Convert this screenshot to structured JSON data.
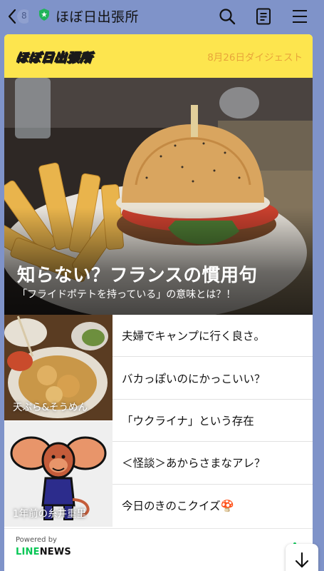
{
  "nav": {
    "back_badge": "8",
    "title": "ほぼ日出張所"
  },
  "card": {
    "logo_text": "ほぼ日出張所",
    "digest_label": "8月26日ダイジェスト",
    "hero": {
      "title": "知らない？フランスの慣用句",
      "subtitle": "「フライドポテトを持っている」の意味とは？！"
    },
    "thumbs": [
      {
        "caption": "天ぷら&そうめん"
      },
      {
        "caption": "1年前の糸井重里"
      }
    ],
    "articles": [
      {
        "title": "夫婦でキャンプに行く良さ。"
      },
      {
        "title": "バカっぽいのにかっこいい？"
      },
      {
        "title": "「ウクライナ」という存在"
      },
      {
        "title": "＜怪談＞あからさまなアレ？"
      },
      {
        "title": "今日のきのこクイズ🍄"
      }
    ],
    "footer": {
      "powered_by": "Powered by",
      "brand_line": "LINE",
      "brand_news": "NEWS"
    }
  },
  "colors": {
    "background": "#7f93c9",
    "header_yellow": "#fde54e",
    "digest_orange": "#e8a53a",
    "line_green": "#06c755"
  },
  "icons": [
    "back-icon",
    "shield-icon",
    "search-icon",
    "notes-icon",
    "menu-icon",
    "arrow-down-icon"
  ]
}
